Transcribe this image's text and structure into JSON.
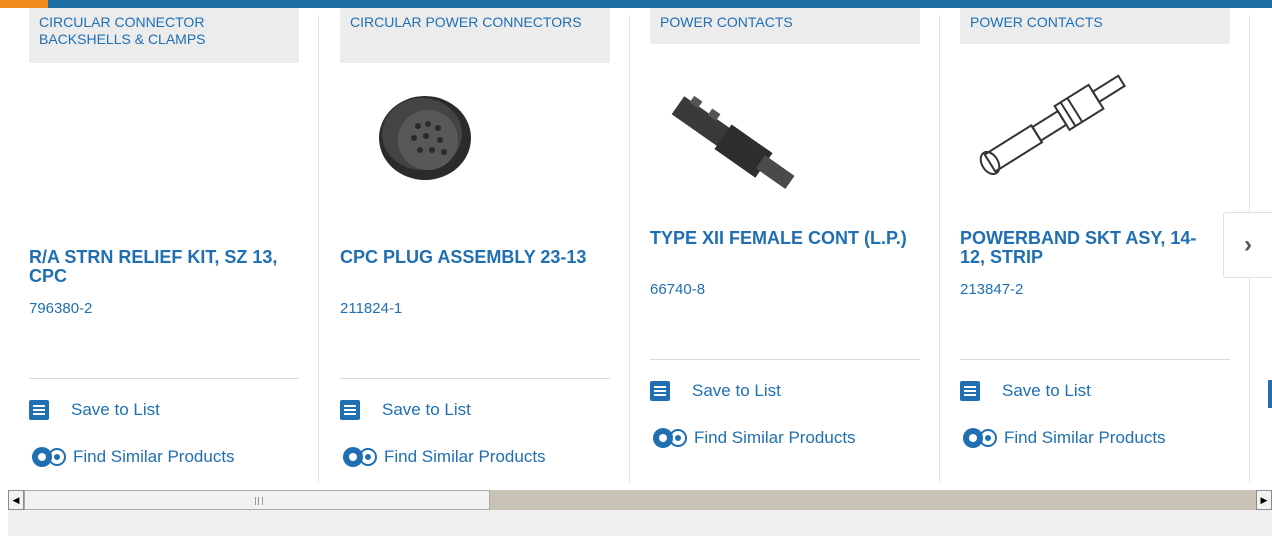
{
  "cards": [
    {
      "category": "CIRCULAR CONNECTOR BACKSHELLS & CLAMPS",
      "title": "R/A STRN RELIEF KIT, SZ 13, CPC",
      "part_number": "796380-2",
      "save_label": "Save to List",
      "similar_label": "Find Similar Products",
      "image": "none"
    },
    {
      "category": "CIRCULAR POWER CONNECTORS",
      "title": "CPC PLUG ASSEMBLY 23-13",
      "part_number": "211824-1",
      "save_label": "Save to List",
      "similar_label": "Find Similar Products",
      "image": "round-plug-connector"
    },
    {
      "category": "POWER CONTACTS",
      "title": "TYPE XII FEMALE CONT (L.P.)",
      "part_number": "66740-8",
      "save_label": "Save to List",
      "similar_label": "Find Similar Products",
      "image": "crimp-contact"
    },
    {
      "category": "POWER CONTACTS",
      "title": "POWERBAND SKT ASY, 14-12, STRIP",
      "part_number": "213847-2",
      "save_label": "Save to List",
      "similar_label": "Find Similar Products",
      "image": "socket-contact"
    }
  ],
  "icons": {
    "save": "checklist-icon",
    "similar": "gears-icon",
    "next": "chevron-right-icon"
  },
  "colors": {
    "link": "#1f6fb2",
    "top_bar": "#1d6fa6",
    "accent": "#f28b1e",
    "category_bg": "#ececec"
  }
}
